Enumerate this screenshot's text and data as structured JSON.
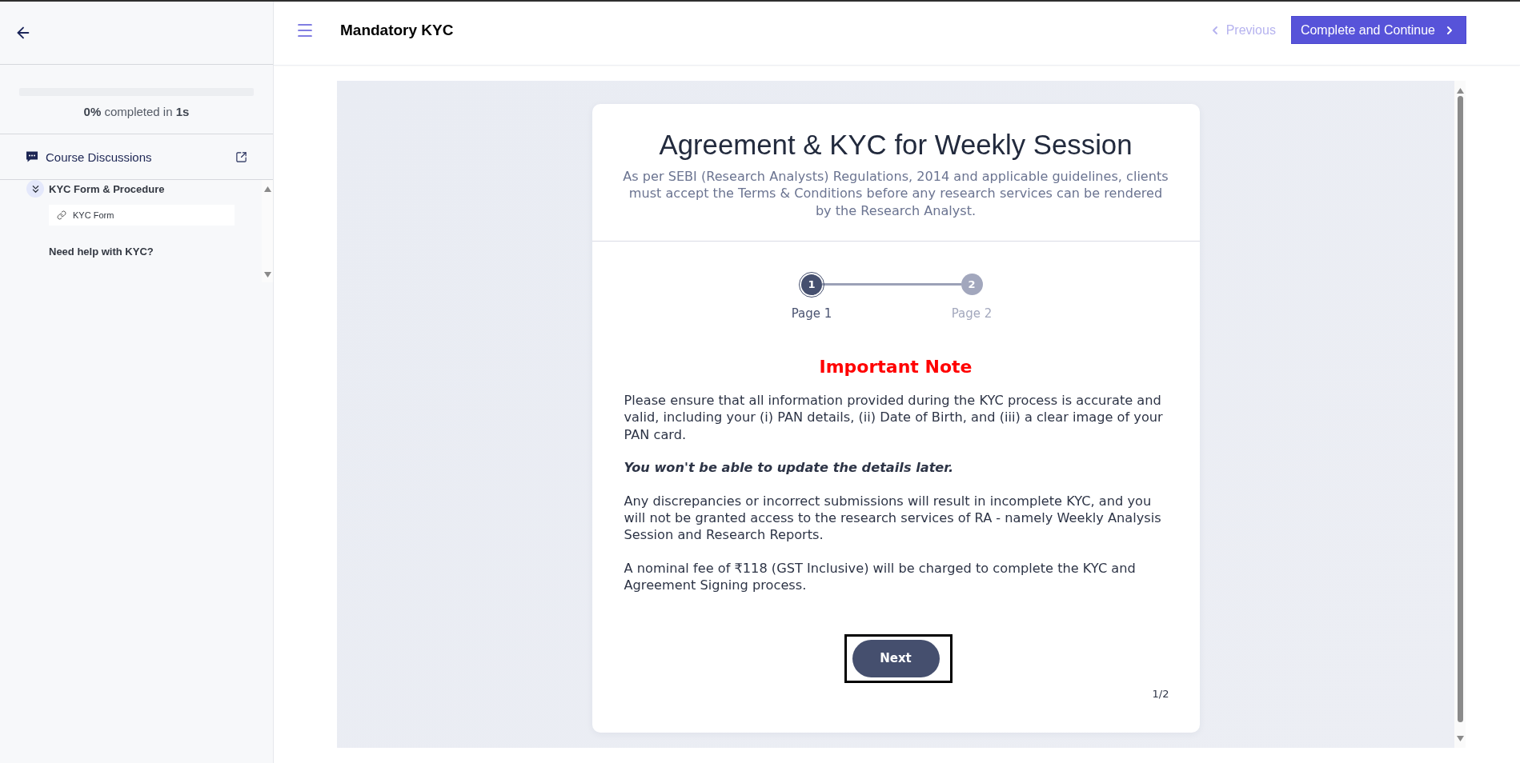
{
  "sidebar": {
    "progress": {
      "level": 0,
      "summary": "**0%** completed in **1s**"
    },
    "discussions": {
      "label": "Course Discussions"
    },
    "sections": [
      {
        "kind": "module",
        "title": "KYC Form & Procedure",
        "expanded": true,
        "lessons": [
          {
            "label": "KYC Form",
            "selected": true
          }
        ]
      },
      {
        "kind": "heading",
        "title": "Need help with KYC?"
      }
    ]
  },
  "header": {
    "title": "Mandatory KYC",
    "previous": {
      "label": "Previous",
      "disabled": true
    },
    "next": {
      "label": "Complete and Continue"
    }
  },
  "card": {
    "title": "Agreement & KYC for Weekly Session",
    "subtitle": "As per SEBI (Research Analysts) Regulations, 2014 and applicable guidelines, clients must accept the Terms & Conditions before any research services can be rendered by the Research Analyst.",
    "steps": [
      {
        "number": "1",
        "label": "Page 1",
        "selected": true
      },
      {
        "number": "2",
        "label": "Page 2",
        "selected": false
      }
    ],
    "note": {
      "heading": "Important Note",
      "paragraphs": [
        {
          "kind": "plain",
          "text": "Please ensure that all information provided during the KYC process is accurate and valid, including your (i) PAN details, (ii) Date of Birth, and (iii) a clear image of your PAN card."
        },
        {
          "kind": "emphasis",
          "text": "You won't be able to update the details later."
        },
        {
          "kind": "plain",
          "text": "Any discrepancies or incorrect submissions will result in incomplete KYC, and you will not be granted access to the research services of RA - namely Weekly Analysis Session and Research Reports."
        },
        {
          "kind": "plain",
          "text": "A nominal fee of ₹118 (GST Inclusive) will be charged to complete the KYC and Agreement Signing process."
        }
      ]
    },
    "button": {
      "label": "Next",
      "focused": true
    },
    "page_indicator": "1/2"
  }
}
